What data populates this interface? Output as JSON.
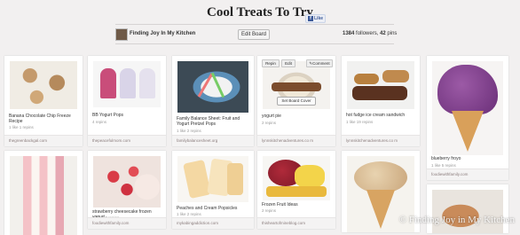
{
  "board": {
    "title": "Cool Treats To Try",
    "like_label": "Like",
    "owner": "Finding Joy In My Kitchen",
    "edit_label": "Edit Board",
    "followers": "1384",
    "followers_suffix": "followers,",
    "pins": "42",
    "pins_suffix": "pins"
  },
  "pins": [
    {
      "desc": "Banana Chocolate Chip Freeze Recipe",
      "stats": "1 like   1 repins",
      "source": "thegreenbackgal.com"
    },
    {
      "desc": "BB Yogurt Pops",
      "stats": "4 repins",
      "source": "thepeacefulmom.com"
    },
    {
      "desc": "Family Balance Sheet: Fruit and Yogurt Pretzel Pops",
      "stats": "1 like   2 repins",
      "source": "familybalancesheet.org"
    },
    {
      "desc": "yogurt pie",
      "stats": "2 repins",
      "source": "lynnskitchenadventures.co m",
      "actions": [
        "Repin",
        "Edit",
        "Comment"
      ],
      "cover_label": "Set Board Cover"
    },
    {
      "desc": "hot fudge ice cream sandwich",
      "stats": "1 like   19 repins",
      "source": "lynnskitchenadventures.co m"
    },
    {
      "desc": "blueberry froyo",
      "stats": "1 like   5 repins",
      "source": "foodiewithfamily.com"
    },
    {
      "desc": "",
      "stats": "",
      "source": ""
    },
    {
      "desc": "strawberry cheesecake frozen yogurt",
      "stats": "1 like   17 repins",
      "source": "foodiewithfamily.com"
    },
    {
      "desc": "Peaches and Cream Popsicles",
      "stats": "1 like   2 repins",
      "source": "mykabingaddiction.com"
    },
    {
      "desc": "Frozen Fruit Ideas",
      "stats": "2 repins",
      "source": "thisheartofmineblog.com"
    },
    {
      "desc": "",
      "stats": "",
      "source": ""
    },
    {
      "desc": "",
      "stats": "",
      "source": ""
    }
  ],
  "watermark": "© Finding Joy in My Kitchen"
}
